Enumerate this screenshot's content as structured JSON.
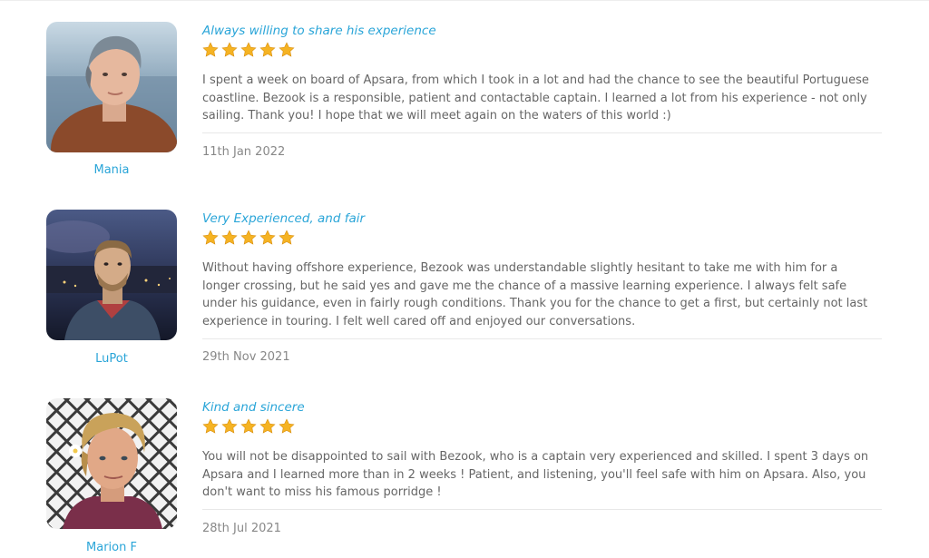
{
  "reviews": [
    {
      "reviewer": "Mania",
      "title": "Always willing to share his experience",
      "rating": 5,
      "body": "I spent a week on board of Apsara, from which I took in a lot and had the chance to see the beautiful Portuguese coastline. Bezook is a responsible, patient and contactable captain. I learned a lot from his experience - not only sailing. Thank you! I hope that we will meet again on the waters of this world :)",
      "date": "11th Jan 2022"
    },
    {
      "reviewer": "LuPot",
      "title": "Very Experienced, and fair",
      "rating": 5,
      "body": "Without having offshore experience, Bezook was understandable slightly hesitant to take me with him for a longer crossing, but he said yes and gave me the chance of a massive learning experience. I always felt safe under his guidance, even in fairly rough conditions. Thank you for the chance to get a first, but certainly not last experience in touring. I felt well cared off and enjoyed our conversations.",
      "date": "29th Nov 2021"
    },
    {
      "reviewer": "Marion F",
      "title": "Kind and sincere",
      "rating": 5,
      "body": "You will not be disappointed to sail with Bezook, who is a captain very experienced and skilled. I spent 3 days on Apsara and I learned more than in 2 weeks ! Patient, and listening, you'll feel safe with him on Apsara. Also, you don't want to miss his famous porridge !",
      "date": "28th Jul 2021"
    }
  ],
  "colors": {
    "accent": "#2aa5d8",
    "star": "#f5b323",
    "text": "#666666"
  },
  "icons": {
    "rating": "star-icon"
  }
}
